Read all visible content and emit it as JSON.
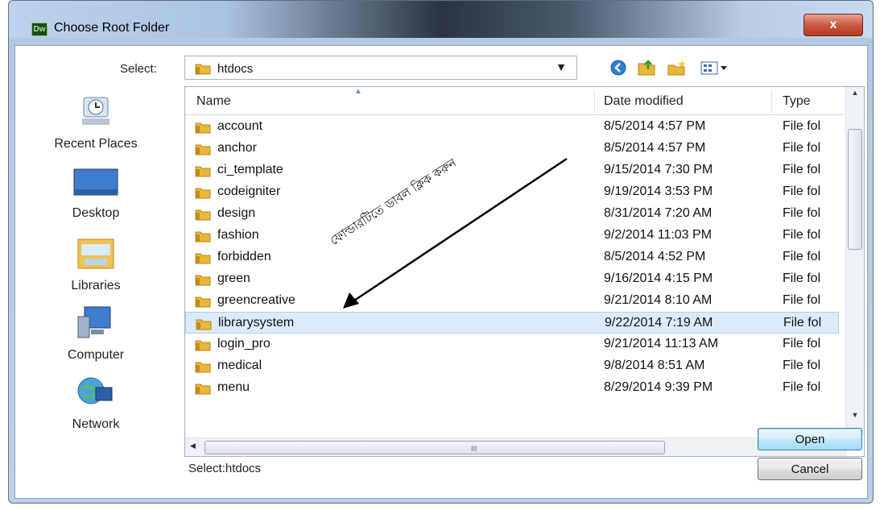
{
  "window": {
    "title": "Choose Root Folder",
    "app_icon_text": "Dw",
    "close_label": "x"
  },
  "select": {
    "label": "Select:",
    "path_value": "htdocs"
  },
  "toolbar": {
    "icons": [
      "back-icon",
      "up-folder-icon",
      "new-folder-icon",
      "view-menu-icon"
    ]
  },
  "places": [
    {
      "label": "Recent Places",
      "icon": "recent-places-icon"
    },
    {
      "label": "Desktop",
      "icon": "desktop-icon"
    },
    {
      "label": "Libraries",
      "icon": "libraries-icon"
    },
    {
      "label": "Computer",
      "icon": "computer-icon"
    },
    {
      "label": "Network",
      "icon": "network-icon"
    }
  ],
  "columns": {
    "name": "Name",
    "date": "Date modified",
    "type": "Type"
  },
  "rows": [
    {
      "name": "account",
      "date": "8/5/2014 4:57 PM",
      "type": "File fol"
    },
    {
      "name": "anchor",
      "date": "8/5/2014 4:57 PM",
      "type": "File fol"
    },
    {
      "name": "ci_template",
      "date": "9/15/2014 7:30 PM",
      "type": "File fol"
    },
    {
      "name": "codeigniter",
      "date": "9/19/2014 3:53 PM",
      "type": "File fol"
    },
    {
      "name": "design",
      "date": "8/31/2014 7:20 AM",
      "type": "File fol"
    },
    {
      "name": "fashion",
      "date": "9/2/2014 11:03 PM",
      "type": "File fol"
    },
    {
      "name": "forbidden",
      "date": "8/5/2014 4:52 PM",
      "type": "File fol"
    },
    {
      "name": "green",
      "date": "9/16/2014 4:15 PM",
      "type": "File fol"
    },
    {
      "name": "greencreative",
      "date": "9/21/2014 8:10 AM",
      "type": "File fol"
    },
    {
      "name": "librarysystem",
      "date": "9/22/2014 7:19 AM",
      "type": "File fol",
      "selected": true
    },
    {
      "name": "login_pro",
      "date": "9/21/2014 11:13 AM",
      "type": "File fol"
    },
    {
      "name": "medical",
      "date": "9/8/2014 8:51 AM",
      "type": "File fol"
    },
    {
      "name": "menu",
      "date": "8/29/2014 9:39 PM",
      "type": "File fol"
    }
  ],
  "scrollbar_grip": "III",
  "status_text": "Select:htdocs",
  "buttons": {
    "open": "Open",
    "cancel": "Cancel"
  },
  "annotation": "ফোল্ডারটিতে ডাবল ক্লিক করুন",
  "colors": {
    "selection": "#dcebfc",
    "folder": "#e8b83a",
    "close": "#c9543b"
  }
}
